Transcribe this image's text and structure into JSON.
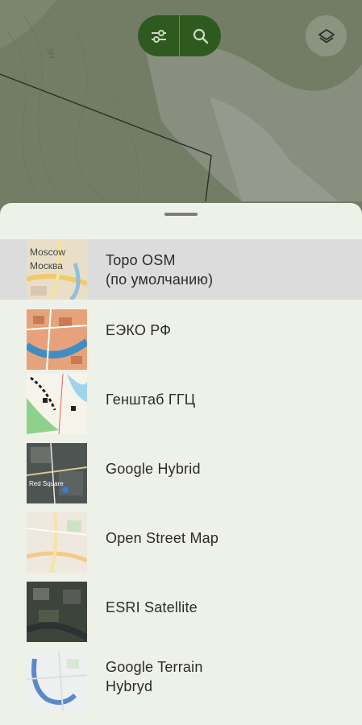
{
  "toolbar": {
    "filter_icon": "sliders-icon",
    "search_icon": "search-icon",
    "layers_icon": "layers-icon"
  },
  "map": {
    "route_label": "ЗП"
  },
  "layers": [
    {
      "line1": "Topo OSM",
      "line2": "(по умолчанию)",
      "selected": true,
      "thumb_text1": "Moscow",
      "thumb_text2": "Москва"
    },
    {
      "line1": "ЕЭКО РФ",
      "line2": ""
    },
    {
      "line1": "Генштаб ГГЦ",
      "line2": ""
    },
    {
      "line1": "Google Hybrid",
      "line2": "",
      "thumb_text1": "Red Square"
    },
    {
      "line1": "Open Street Map",
      "line2": ""
    },
    {
      "line1": "ESRI Satellite",
      "line2": ""
    },
    {
      "line1": "Google Terrain",
      "line2": "Hybryd"
    }
  ]
}
